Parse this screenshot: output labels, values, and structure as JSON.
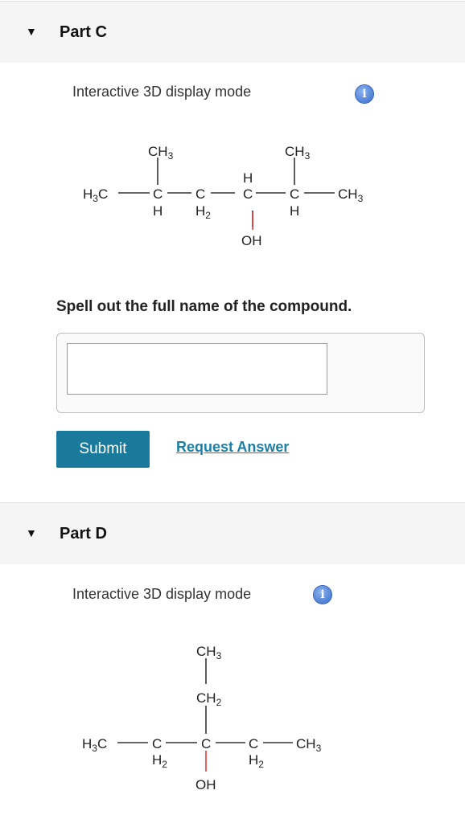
{
  "partC": {
    "title": "Part C",
    "mode_label": "Interactive 3D display mode",
    "info_icon": "info-icon",
    "question": "Spell out the full name of the compound.",
    "submit_label": "Submit",
    "request_label": "Request Answer",
    "answer_value": "",
    "molecule": {
      "ch3_a": "CH",
      "ch3_a_sub": "3",
      "ch3_b": "CH",
      "ch3_b_sub": "3",
      "h3c": "H",
      "h3c_sub": "3",
      "h3c_c": "C",
      "c1": "C",
      "h1": "H",
      "c2": "C",
      "h2": "H",
      "h2_sub": "2",
      "c3": "C",
      "h3top": "H",
      "c4": "C",
      "h4": "H",
      "ch3_end": "CH",
      "ch3_end_sub": "3",
      "oh": "OH"
    }
  },
  "partD": {
    "title": "Part D",
    "mode_label": "Interactive 3D display mode",
    "info_icon": "info-icon",
    "molecule": {
      "ch3_top": "CH",
      "ch3_top_sub": "3",
      "ch2": "CH",
      "ch2_sub": "2",
      "h3c": "H",
      "h3c_sub": "3",
      "h3c_c": "C",
      "c1": "C",
      "c1h": "H",
      "c1h_sub": "2",
      "c2": "C",
      "c3": "C",
      "c3h": "H",
      "c3h_sub": "2",
      "ch3_end": "CH",
      "ch3_end_sub": "3",
      "oh": "OH"
    }
  },
  "colors": {
    "accent": "#1a7a9c",
    "link": "#1b7fa8",
    "oh_bond": "#e53935",
    "header_bg": "#f5f5f5"
  }
}
